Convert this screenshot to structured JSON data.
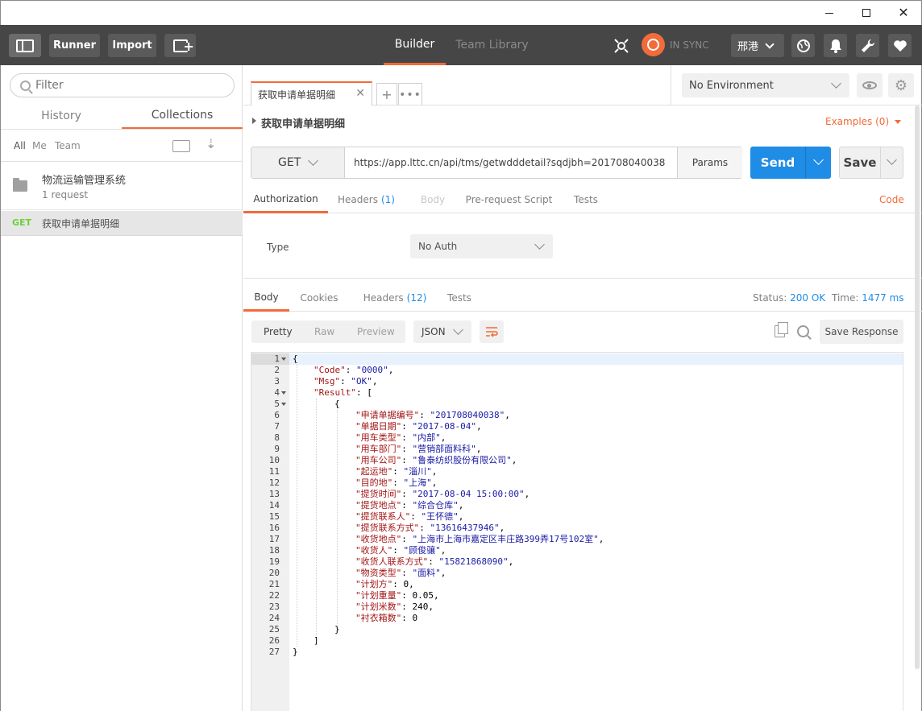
{
  "window": {
    "minimize": "—",
    "maximize": "□",
    "close": "✕"
  },
  "header": {
    "runner": "Runner",
    "import": "Import",
    "tabs": [
      {
        "label": "Builder"
      },
      {
        "label": "Team Library"
      }
    ],
    "sync_label": "IN SYNC",
    "user": "邢港"
  },
  "sidebar": {
    "filter_placeholder": "Filter",
    "tabs": [
      {
        "label": "History"
      },
      {
        "label": "Collections"
      }
    ],
    "filters": [
      "All",
      "Me",
      "Team"
    ],
    "collection": {
      "name": "物流运输管理系统",
      "count": "1 request"
    },
    "request": {
      "method": "GET",
      "name": "获取申请单据明细"
    }
  },
  "main": {
    "tab_title": "获取申请单据明细",
    "environment": "No Environment",
    "request_title": "获取申请单据明细",
    "examples": "Examples (0)",
    "method": "GET",
    "url": "https://app.lttc.cn/api/tms/getwdddetail?sqdjbh=201708040038",
    "params": "Params",
    "send": "Send",
    "save": "Save",
    "request_tabs": [
      {
        "label": "Authorization",
        "count": ""
      },
      {
        "label": "Headers",
        "count": "(1)"
      },
      {
        "label": "Body",
        "count": ""
      },
      {
        "label": "Pre-request Script",
        "count": ""
      },
      {
        "label": "Tests",
        "count": ""
      }
    ],
    "code": "Code",
    "auth": {
      "type_label": "Type",
      "type_value": "No Auth"
    },
    "response_tabs": [
      {
        "label": "Body",
        "count": ""
      },
      {
        "label": "Cookies",
        "count": ""
      },
      {
        "label": "Headers",
        "count": "(12)"
      },
      {
        "label": "Tests",
        "count": ""
      }
    ],
    "status_label": "Status:",
    "status_value": "200 OK",
    "time_label": "Time:",
    "time_value": "1477 ms",
    "view_modes": [
      "Pretty",
      "Raw",
      "Preview"
    ],
    "format": "JSON",
    "save_response": "Save Response"
  },
  "response_lines": [
    {
      "n": "1",
      "fold": true,
      "indent": 0,
      "parts": [
        [
          "n",
          "{"
        ]
      ]
    },
    {
      "n": "2",
      "fold": false,
      "indent": 1,
      "parts": [
        [
          "k",
          "\"Code\""
        ],
        [
          "n",
          ": "
        ],
        [
          "s",
          "\"0000\""
        ],
        [
          "n",
          ","
        ]
      ]
    },
    {
      "n": "3",
      "fold": false,
      "indent": 1,
      "parts": [
        [
          "k",
          "\"Msg\""
        ],
        [
          "n",
          ": "
        ],
        [
          "s",
          "\"OK\""
        ],
        [
          "n",
          ","
        ]
      ]
    },
    {
      "n": "4",
      "fold": true,
      "indent": 1,
      "parts": [
        [
          "k",
          "\"Result\""
        ],
        [
          "n",
          ": ["
        ]
      ]
    },
    {
      "n": "5",
      "fold": true,
      "indent": 2,
      "parts": [
        [
          "n",
          "{"
        ]
      ]
    },
    {
      "n": "6",
      "fold": false,
      "indent": 3,
      "parts": [
        [
          "k",
          "\"申请单据编号\""
        ],
        [
          "n",
          ": "
        ],
        [
          "s",
          "\"201708040038\""
        ],
        [
          "n",
          ","
        ]
      ]
    },
    {
      "n": "7",
      "fold": false,
      "indent": 3,
      "parts": [
        [
          "k",
          "\"单据日期\""
        ],
        [
          "n",
          ": "
        ],
        [
          "s",
          "\"2017-08-04\""
        ],
        [
          "n",
          ","
        ]
      ]
    },
    {
      "n": "8",
      "fold": false,
      "indent": 3,
      "parts": [
        [
          "k",
          "\"用车类型\""
        ],
        [
          "n",
          ": "
        ],
        [
          "s",
          "\"内部\""
        ],
        [
          "n",
          ","
        ]
      ]
    },
    {
      "n": "9",
      "fold": false,
      "indent": 3,
      "parts": [
        [
          "k",
          "\"用车部门\""
        ],
        [
          "n",
          ": "
        ],
        [
          "s",
          "\"营销部面料科\""
        ],
        [
          "n",
          ","
        ]
      ]
    },
    {
      "n": "10",
      "fold": false,
      "indent": 3,
      "parts": [
        [
          "k",
          "\"用车公司\""
        ],
        [
          "n",
          ": "
        ],
        [
          "s",
          "\"鲁泰纺织股份有限公司\""
        ],
        [
          "n",
          ","
        ]
      ]
    },
    {
      "n": "11",
      "fold": false,
      "indent": 3,
      "parts": [
        [
          "k",
          "\"起运地\""
        ],
        [
          "n",
          ": "
        ],
        [
          "s",
          "\"淄川\""
        ],
        [
          "n",
          ","
        ]
      ]
    },
    {
      "n": "12",
      "fold": false,
      "indent": 3,
      "parts": [
        [
          "k",
          "\"目的地\""
        ],
        [
          "n",
          ": "
        ],
        [
          "s",
          "\"上海\""
        ],
        [
          "n",
          ","
        ]
      ]
    },
    {
      "n": "13",
      "fold": false,
      "indent": 3,
      "parts": [
        [
          "k",
          "\"提货时间\""
        ],
        [
          "n",
          ": "
        ],
        [
          "s",
          "\"2017-08-04 15:00:00\""
        ],
        [
          "n",
          ","
        ]
      ]
    },
    {
      "n": "14",
      "fold": false,
      "indent": 3,
      "parts": [
        [
          "k",
          "\"提货地点\""
        ],
        [
          "n",
          ": "
        ],
        [
          "s",
          "\"综合仓库\""
        ],
        [
          "n",
          ","
        ]
      ]
    },
    {
      "n": "15",
      "fold": false,
      "indent": 3,
      "parts": [
        [
          "k",
          "\"提货联系人\""
        ],
        [
          "n",
          ": "
        ],
        [
          "s",
          "\"王怀德\""
        ],
        [
          "n",
          ","
        ]
      ]
    },
    {
      "n": "16",
      "fold": false,
      "indent": 3,
      "parts": [
        [
          "k",
          "\"提货联系方式\""
        ],
        [
          "n",
          ": "
        ],
        [
          "s",
          "\"13616437946\""
        ],
        [
          "n",
          ","
        ]
      ]
    },
    {
      "n": "17",
      "fold": false,
      "indent": 3,
      "parts": [
        [
          "k",
          "\"收货地点\""
        ],
        [
          "n",
          ": "
        ],
        [
          "s",
          "\"上海市上海市嘉定区丰庄路399弄17号102室\""
        ],
        [
          "n",
          ","
        ]
      ]
    },
    {
      "n": "18",
      "fold": false,
      "indent": 3,
      "parts": [
        [
          "k",
          "\"收货人\""
        ],
        [
          "n",
          ": "
        ],
        [
          "s",
          "\"顾俊骧\""
        ],
        [
          "n",
          ","
        ]
      ]
    },
    {
      "n": "19",
      "fold": false,
      "indent": 3,
      "parts": [
        [
          "k",
          "\"收货人联系方式\""
        ],
        [
          "n",
          ": "
        ],
        [
          "s",
          "\"15821868090\""
        ],
        [
          "n",
          ","
        ]
      ]
    },
    {
      "n": "20",
      "fold": false,
      "indent": 3,
      "parts": [
        [
          "k",
          "\"物资类型\""
        ],
        [
          "n",
          ": "
        ],
        [
          "s",
          "\"面料\""
        ],
        [
          "n",
          ","
        ]
      ]
    },
    {
      "n": "21",
      "fold": false,
      "indent": 3,
      "parts": [
        [
          "k",
          "\"计划方\""
        ],
        [
          "n",
          ": 0,"
        ]
      ]
    },
    {
      "n": "22",
      "fold": false,
      "indent": 3,
      "parts": [
        [
          "k",
          "\"计划重量\""
        ],
        [
          "n",
          ": 0.05,"
        ]
      ]
    },
    {
      "n": "23",
      "fold": false,
      "indent": 3,
      "parts": [
        [
          "k",
          "\"计划米数\""
        ],
        [
          "n",
          ": 240,"
        ]
      ]
    },
    {
      "n": "24",
      "fold": false,
      "indent": 3,
      "parts": [
        [
          "k",
          "\"衬衣箱数\""
        ],
        [
          "n",
          ": 0"
        ]
      ]
    },
    {
      "n": "25",
      "fold": false,
      "indent": 2,
      "parts": [
        [
          "n",
          "}"
        ]
      ]
    },
    {
      "n": "26",
      "fold": false,
      "indent": 1,
      "parts": [
        [
          "n",
          "]"
        ]
      ]
    },
    {
      "n": "27",
      "fold": false,
      "indent": 0,
      "parts": [
        [
          "n",
          "}"
        ]
      ]
    }
  ]
}
